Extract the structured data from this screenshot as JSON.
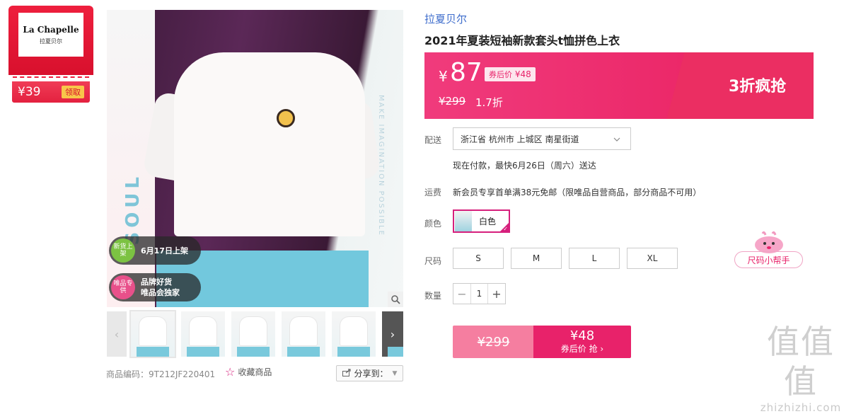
{
  "coupon": {
    "brand_en": "La Chapelle",
    "brand_cn": "拉夏贝尔",
    "price": "¥39",
    "claim": "领取"
  },
  "gallery": {
    "vertical_text_left": "SOUL",
    "vertical_text_right": "MAKE IMAGINATION POSSIBLE",
    "badge_new": {
      "circle": "新货上架",
      "text": "6月17日上架",
      "color": "#7cc242"
    },
    "badge_brand": {
      "circle": "唯品专供",
      "text_line1": "品牌好货",
      "text_line2": "唯品会独家",
      "color": "#e8508a"
    },
    "zoom_icon": "magnifier-icon",
    "thumb_prev": "‹",
    "thumb_next": "›"
  },
  "footer_left": {
    "code": "商品编码：9T212JF220401",
    "favorite": "收藏商品",
    "share": "分享到："
  },
  "product": {
    "brand": "拉夏贝尔",
    "title": "2021年夏装短袖新款套头t恤拼色上衣",
    "currency": "¥",
    "price": "87",
    "after_coupon_label": "券后价",
    "after_coupon_price": "¥48",
    "original_price": "¥299",
    "discount": "1.7折",
    "promo": "3折疯抢"
  },
  "delivery": {
    "label": "配送",
    "address": "浙江省 杭州市 上城区 南星街道",
    "note": "现在付款，最快6月26日（周六）送达"
  },
  "shipping": {
    "label": "运费",
    "note": "新会员专享首单满38元免邮（限唯品自营商品，部分商品不可用）"
  },
  "color": {
    "label": "颜色",
    "selected": "白色"
  },
  "size": {
    "label": "尺码",
    "options": [
      "S",
      "M",
      "L",
      "XL"
    ],
    "helper": "尺码小帮手"
  },
  "quantity": {
    "label": "数量",
    "minus": "−",
    "value": "1",
    "plus": "+"
  },
  "buy": {
    "original": "¥299",
    "price": "¥48",
    "action": "券后价 抢 ›"
  },
  "watermark": {
    "big": "值值值",
    "small": "zhizhizhi.com"
  }
}
